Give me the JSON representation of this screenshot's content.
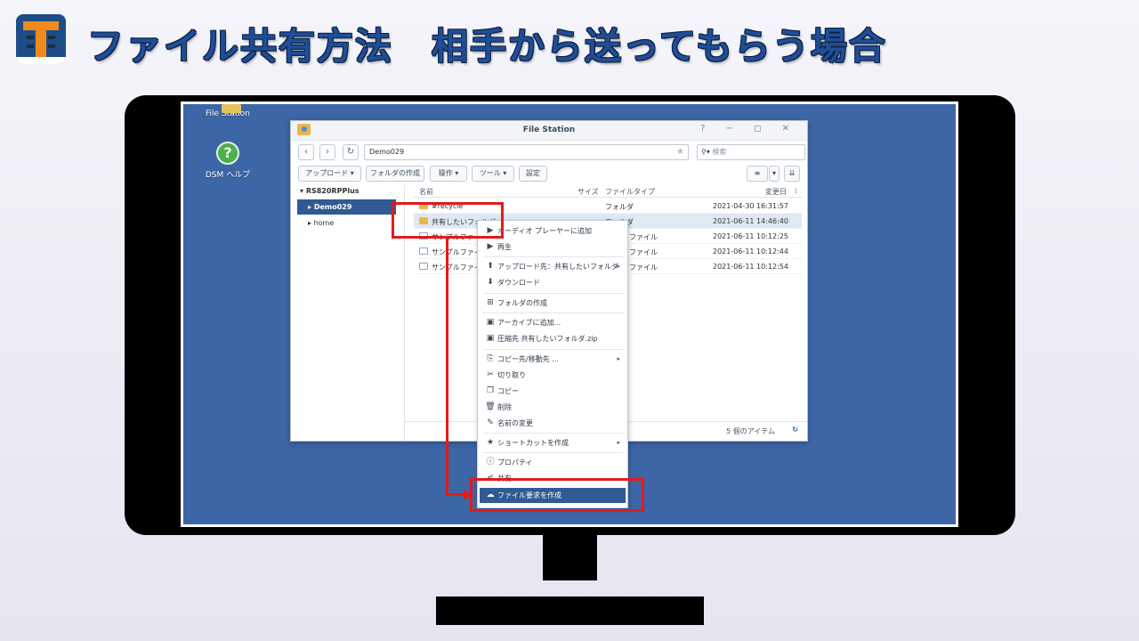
{
  "slide": {
    "title": "ファイル共有方法　相手から送ってもらう場合",
    "logo_icon": "tiger-t-logo-icon"
  },
  "desktop": {
    "icons": [
      {
        "label": "File Station",
        "icon": "file-station-icon"
      },
      {
        "label": "DSM ヘルプ",
        "icon": "help-icon"
      }
    ],
    "help_glyph": "?"
  },
  "window": {
    "title": "File Station",
    "controls": "? − ◻ ✕",
    "path": "Demo029",
    "search_placeholder": "検索",
    "toolbar": {
      "upload": "アップロード ▾",
      "create_folder": "フォルダの作成",
      "action": "操作 ▾",
      "tools": "ツール ▾",
      "settings": "設定"
    },
    "tree": {
      "root": "RS820RPPlus",
      "items": [
        "Demo029",
        "home"
      ]
    },
    "columns": {
      "name": "名前",
      "size": "サイズ",
      "type": "ファイルタイプ",
      "modified": "変更日"
    },
    "rows": [
      {
        "name": "#recycle",
        "type": "フォルダ",
        "modified": "2021-04-30 16:31:57",
        "kind": "folder"
      },
      {
        "name": "共有したいフォルダ",
        "type": "フォルダ",
        "modified": "2021-06-11 14:46:40",
        "kind": "folder"
      },
      {
        "name": "サンプルファ",
        "type": "ファイル",
        "modified": "2021-06-11 10:12:25",
        "kind": "file"
      },
      {
        "name": "サンプルファイ",
        "type": "ファイル",
        "modified": "2021-06-11 10:12:44",
        "kind": "file"
      },
      {
        "name": "サンプルファイ",
        "type": "ファイル",
        "modified": "2021-06-11 10:12:54",
        "kind": "file"
      }
    ],
    "status": "5 個のアイテム"
  },
  "context_menu": {
    "items": [
      {
        "label": "オーディオ プレーヤーに追加",
        "icon": "play-icon"
      },
      {
        "label": "再生",
        "icon": "play-icon"
      },
      {
        "label": "アップロード先：共有したいフォルダ",
        "icon": "upload-icon",
        "submenu": true
      },
      {
        "label": "ダウンロード",
        "icon": "download-icon"
      },
      {
        "label": "フォルダの作成",
        "icon": "new-folder-icon"
      },
      {
        "label": "アーカイブに追加...",
        "icon": "archive-icon"
      },
      {
        "label": "圧縮先 共有したいフォルダ.zip",
        "icon": "archive-icon"
      },
      {
        "label": "コピー先/移動先 ...",
        "icon": "copy-move-icon",
        "submenu": true
      },
      {
        "label": "切り取り",
        "icon": "scissors-icon"
      },
      {
        "label": "コピー",
        "icon": "copy-icon"
      },
      {
        "label": "削除",
        "icon": "trash-icon"
      },
      {
        "label": "名前の変更",
        "icon": "pencil-icon"
      },
      {
        "label": "ショートカットを作成",
        "icon": "star-icon",
        "submenu": true
      },
      {
        "label": "プロパティ",
        "icon": "info-icon"
      },
      {
        "label": "共有",
        "icon": "share-icon"
      },
      {
        "label": "ファイル要求を作成",
        "icon": "cloud-upload-icon",
        "active": true
      }
    ]
  },
  "colors": {
    "desktop_bg": "#3d66a6",
    "selection": "#2f5a93",
    "annotation_red": "#e31b1b",
    "title_blue": "#1f4e97"
  }
}
